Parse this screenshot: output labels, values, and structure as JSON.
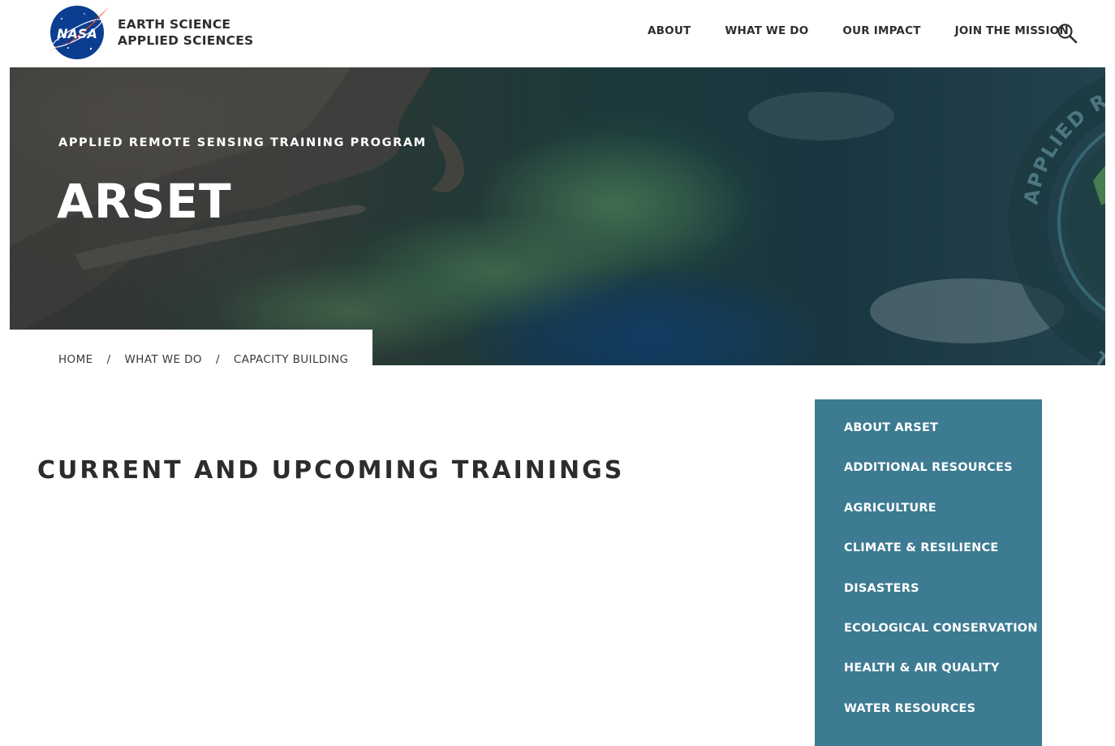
{
  "brand": {
    "logo_text": "NASA",
    "line1": "EARTH SCIENCE",
    "line2": "APPLIED SCIENCES"
  },
  "nav": {
    "items": [
      "ABOUT",
      "WHAT WE DO",
      "OUR IMPACT",
      "JOIN THE MISSION"
    ],
    "search_icon": "search-icon"
  },
  "hero": {
    "kicker": "APPLIED REMOTE SENSING TRAINING PROGRAM",
    "title": "ARSET",
    "badge_text": "APPLIED REMO",
    "badge_text_bottom": "TR"
  },
  "breadcrumb": {
    "items": [
      "HOME",
      "WHAT WE DO",
      "CAPACITY BUILDING"
    ],
    "separator": "/"
  },
  "main": {
    "heading": "CURRENT AND UPCOMING TRAININGS"
  },
  "sidebar": {
    "items": [
      "ABOUT ARSET",
      "ADDITIONAL RESOURCES",
      "AGRICULTURE",
      "CLIMATE & RESILIENCE",
      "DISASTERS",
      "ECOLOGICAL CONSERVATION",
      "HEALTH & AIR QUALITY",
      "WATER RESOURCES"
    ]
  },
  "colors": {
    "sidebar_bg": "#3d7b92",
    "nasa_blue": "#0b3d91",
    "nasa_red": "#fc3d21",
    "text_dark": "#2c2c2c"
  }
}
